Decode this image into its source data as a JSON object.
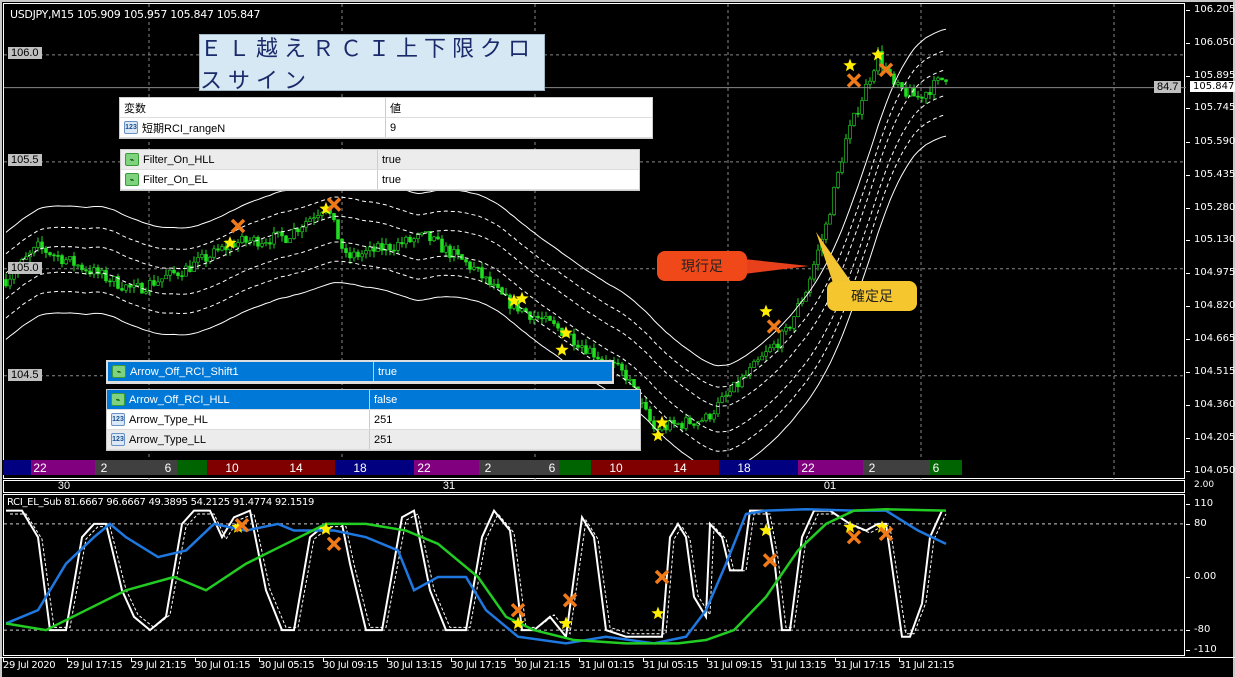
{
  "header": {
    "title": "USDJPY,M15  105.909 105.957 105.847 105.847"
  },
  "banner": {
    "text": "ＥＬ越えＲＣＩ上下限クロスサイン"
  },
  "price_axis": {
    "labels": [
      "106.205",
      "106.050",
      "105.895",
      "105.745",
      "105.590",
      "105.435",
      "105.280",
      "105.130",
      "104.975",
      "104.820",
      "104.665",
      "104.515",
      "104.360",
      "104.205",
      "104.050"
    ],
    "current_price": "105.847",
    "current_marker": "84.7"
  },
  "level_labels": [
    "106.0",
    "105.5",
    "105.0",
    "104.5"
  ],
  "params_top": {
    "header": [
      "変数",
      "値"
    ],
    "rows": [
      {
        "name": "短期RCI_rangeN",
        "value": "9",
        "type": "num"
      }
    ]
  },
  "params_mid": {
    "rows": [
      {
        "name": "Filter_On_HLL",
        "value": "true",
        "type": "bool"
      },
      {
        "name": "Filter_On_EL",
        "value": "true",
        "type": "bool"
      }
    ]
  },
  "params_shift": {
    "rows": [
      {
        "name": "Arrow_Off_RCI_Shift1",
        "value": "true",
        "type": "bool"
      }
    ]
  },
  "params_bottom": {
    "rows": [
      {
        "name": "Arrow_Off_RCI_HLL",
        "value": "false",
        "type": "bool"
      },
      {
        "name": "Arrow_Type_HL",
        "value": "251",
        "type": "num"
      },
      {
        "name": "Arrow_Type_LL",
        "value": "251",
        "type": "num"
      }
    ]
  },
  "callouts": {
    "current": "現行足",
    "confirmed": "確定足"
  },
  "session_bar": {
    "labels": [
      "22",
      "2",
      "6",
      "10",
      "14",
      "18",
      "22",
      "2",
      "6",
      "10",
      "14",
      "18",
      "22",
      "2",
      "6"
    ],
    "colors": {
      "blue": "#000080",
      "purple": "#800080",
      "gray": "#404040",
      "green": "#006400",
      "red": "#800000"
    }
  },
  "day_labels": [
    "30",
    "31",
    "01"
  ],
  "sub_window": {
    "title": "RCI_EL_Sub 81.6667 96.6667 49.3895 54.2125 91.4774 92.1519",
    "axis_labels": [
      "110",
      "80",
      "0.00",
      "-80",
      "-110"
    ],
    "corner_label": "2.00"
  },
  "time_axis": [
    "29 Jul 2020",
    "29 Jul 17:15",
    "29 Jul 21:15",
    "30 Jul 01:15",
    "30 Jul 05:15",
    "30 Jul 09:15",
    "30 Jul 13:15",
    "30 Jul 17:15",
    "30 Jul 21:15",
    "31 Jul 01:15",
    "31 Jul 05:15",
    "31 Jul 09:15",
    "31 Jul 13:15",
    "31 Jul 17:15",
    "31 Jul 21:15"
  ],
  "chart_data": {
    "type": "line",
    "symbol": "USDJPY",
    "timeframe": "M15",
    "price_range": [
      104.05,
      106.205
    ],
    "price_path": [
      [
        0,
        104.95
      ],
      [
        8,
        105.1
      ],
      [
        20,
        105.0
      ],
      [
        32,
        104.9
      ],
      [
        45,
        105.0
      ],
      [
        57,
        105.12
      ],
      [
        70,
        105.15
      ],
      [
        80,
        105.3
      ],
      [
        85,
        105.05
      ],
      [
        105,
        105.15
      ],
      [
        117,
        105.0
      ],
      [
        125,
        104.85
      ],
      [
        140,
        104.7
      ],
      [
        155,
        104.5
      ],
      [
        162,
        104.25
      ],
      [
        175,
        104.3
      ],
      [
        185,
        104.5
      ],
      [
        195,
        104.7
      ],
      [
        200,
        104.9
      ],
      [
        205,
        105.2
      ],
      [
        210,
        105.6
      ],
      [
        215,
        105.85
      ],
      [
        218,
        106.0
      ],
      [
        222,
        105.85
      ],
      [
        228,
        105.8
      ],
      [
        235,
        105.9
      ]
    ],
    "price_signals": [
      [
        56,
        105.12,
        "star"
      ],
      [
        58,
        105.2,
        "x"
      ],
      [
        80,
        105.28,
        "star"
      ],
      [
        82,
        105.3,
        "x"
      ],
      [
        127,
        104.85,
        "star"
      ],
      [
        129,
        104.86,
        "star"
      ],
      [
        139,
        104.62,
        "star"
      ],
      [
        140,
        104.7,
        "star"
      ],
      [
        163,
        104.22,
        "star"
      ],
      [
        164,
        104.28,
        "star"
      ],
      [
        190,
        104.8,
        "star"
      ],
      [
        192,
        104.73,
        "x"
      ],
      [
        211,
        105.95,
        "star"
      ],
      [
        212,
        105.88,
        "x"
      ],
      [
        218,
        106.0,
        "star"
      ],
      [
        220,
        105.93,
        "x"
      ]
    ],
    "osc_range": [
      -110,
      110
    ],
    "osc_levels": [
      80,
      -80
    ],
    "series": [
      {
        "name": "RCI short",
        "color": "#ffffff",
        "points": [
          [
            0,
            100
          ],
          [
            4,
            100
          ],
          [
            8,
            60
          ],
          [
            11,
            -80
          ],
          [
            15,
            -80
          ],
          [
            19,
            60
          ],
          [
            22,
            80
          ],
          [
            25,
            80
          ],
          [
            29,
            -20
          ],
          [
            32,
            -60
          ],
          [
            36,
            -80
          ],
          [
            40,
            -60
          ],
          [
            44,
            80
          ],
          [
            47,
            100
          ],
          [
            51,
            100
          ],
          [
            54,
            60
          ],
          [
            57,
            90
          ],
          [
            61,
            100
          ],
          [
            65,
            -20
          ],
          [
            69,
            -80
          ],
          [
            72,
            -80
          ],
          [
            76,
            60
          ],
          [
            80,
            80
          ],
          [
            84,
            80
          ],
          [
            86,
            20
          ],
          [
            90,
            -80
          ],
          [
            94,
            -80
          ],
          [
            99,
            90
          ],
          [
            102,
            100
          ],
          [
            106,
            -20
          ],
          [
            110,
            -80
          ],
          [
            115,
            -80
          ],
          [
            119,
            60
          ],
          [
            122,
            100
          ],
          [
            126,
            70
          ],
          [
            129,
            -80
          ],
          [
            132,
            -80
          ],
          [
            136,
            -60
          ],
          [
            140,
            -90
          ],
          [
            144,
            90
          ],
          [
            147,
            60
          ],
          [
            150,
            -80
          ],
          [
            155,
            -90
          ],
          [
            164,
            -90
          ],
          [
            166,
            60
          ],
          [
            168,
            80
          ],
          [
            170,
            60
          ],
          [
            172,
            -30
          ],
          [
            175,
            -60
          ],
          [
            176,
            80
          ],
          [
            179,
            60
          ],
          [
            181,
            10
          ],
          [
            184,
            10
          ],
          [
            186,
            100
          ],
          [
            190,
            100
          ],
          [
            192,
            30
          ],
          [
            194,
            -80
          ],
          [
            196,
            -80
          ],
          [
            199,
            60
          ],
          [
            202,
            100
          ],
          [
            206,
            100
          ],
          [
            211,
            80
          ],
          [
            215,
            70
          ],
          [
            218,
            80
          ],
          [
            220,
            80
          ],
          [
            224,
            -90
          ],
          [
            226,
            -90
          ],
          [
            229,
            -40
          ],
          [
            231,
            60
          ],
          [
            234,
            100
          ]
        ]
      },
      {
        "name": "RCI mid",
        "color": "#1e78e0",
        "points": [
          [
            0,
            -70
          ],
          [
            8,
            -50
          ],
          [
            15,
            20
          ],
          [
            22,
            60
          ],
          [
            26,
            80
          ],
          [
            30,
            60
          ],
          [
            38,
            30
          ],
          [
            45,
            40
          ],
          [
            52,
            80
          ],
          [
            60,
            70
          ],
          [
            68,
            80
          ],
          [
            72,
            70
          ],
          [
            82,
            70
          ],
          [
            90,
            60
          ],
          [
            98,
            40
          ],
          [
            102,
            -20
          ],
          [
            108,
            0
          ],
          [
            115,
            0
          ],
          [
            120,
            -50
          ],
          [
            128,
            -90
          ],
          [
            140,
            -100
          ],
          [
            150,
            -90
          ],
          [
            162,
            -100
          ],
          [
            170,
            -90
          ],
          [
            175,
            -50
          ],
          [
            180,
            20
          ],
          [
            185,
            95
          ],
          [
            190,
            100
          ],
          [
            200,
            102
          ],
          [
            212,
            100
          ],
          [
            220,
            100
          ],
          [
            228,
            70
          ],
          [
            235,
            50
          ]
        ]
      },
      {
        "name": "RCI long",
        "color": "#22cc22",
        "points": [
          [
            0,
            -70
          ],
          [
            10,
            -80
          ],
          [
            20,
            -50
          ],
          [
            30,
            -20
          ],
          [
            42,
            0
          ],
          [
            50,
            -20
          ],
          [
            60,
            20
          ],
          [
            70,
            50
          ],
          [
            80,
            80
          ],
          [
            90,
            80
          ],
          [
            100,
            70
          ],
          [
            108,
            50
          ],
          [
            118,
            0
          ],
          [
            125,
            -60
          ],
          [
            132,
            -80
          ],
          [
            142,
            -95
          ],
          [
            155,
            -100
          ],
          [
            168,
            -100
          ],
          [
            175,
            -95
          ],
          [
            182,
            -80
          ],
          [
            190,
            -30
          ],
          [
            198,
            40
          ],
          [
            205,
            80
          ],
          [
            212,
            100
          ],
          [
            220,
            102
          ],
          [
            235,
            100
          ]
        ]
      }
    ],
    "osc_signals": [
      [
        58,
        75,
        "star"
      ],
      [
        59,
        78,
        "x"
      ],
      [
        80,
        72,
        "star"
      ],
      [
        82,
        50,
        "x"
      ],
      [
        128,
        -70,
        "star"
      ],
      [
        128,
        -50,
        "x"
      ],
      [
        140,
        -70,
        "star"
      ],
      [
        141,
        -35,
        "x"
      ],
      [
        163,
        -55,
        "star"
      ],
      [
        164,
        0,
        "x"
      ],
      [
        190,
        70,
        "star"
      ],
      [
        191,
        25,
        "x"
      ],
      [
        211,
        75,
        "star"
      ],
      [
        212,
        60,
        "x"
      ],
      [
        219,
        75,
        "star"
      ],
      [
        220,
        65,
        "x"
      ]
    ]
  }
}
